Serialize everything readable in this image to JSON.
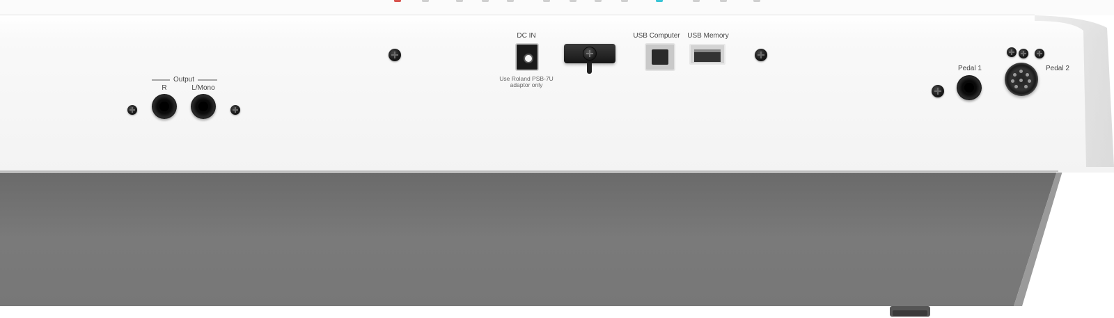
{
  "panel": {
    "output_group_label": "Output",
    "output_r_label": "R",
    "output_l_label": "L/Mono",
    "dcin_label": "DC IN",
    "dcin_note_line1": "Use Roland PSB-7U",
    "dcin_note_line2": "adaptor only",
    "usb_computer_label": "USB Computer",
    "usb_memory_label": "USB Memory",
    "pedal1_label": "Pedal 1",
    "pedal2_label": "Pedal 2"
  },
  "colors": {
    "panel_white": "#f6f6f6",
    "underside_gray": "#7a7a7a",
    "key_red": "#d9544f",
    "key_cyan": "#39c4d6"
  },
  "icons": {
    "screw": "screw-icon",
    "jack": "phone-jack-icon",
    "dc_jack": "dc-jack-icon",
    "usb_b": "usb-b-port-icon",
    "usb_a": "usb-a-port-icon",
    "din": "din-connector-icon"
  }
}
